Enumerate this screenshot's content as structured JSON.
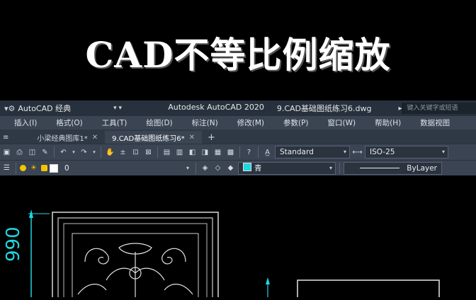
{
  "banner": {
    "title": "CAD不等比例缩放"
  },
  "titlebar": {
    "workspace": "AutoCAD 经典",
    "app_name": "Autodesk AutoCAD 2020",
    "file_name": "9.CAD基础图纸练习6.dwg",
    "search_placeholder": "键入关键字或短语"
  },
  "menu": {
    "items": [
      "插入(I)",
      "格式(O)",
      "工具(T)",
      "绘图(D)",
      "标注(N)",
      "修改(M)",
      "参数(P)",
      "窗口(W)",
      "帮助(H)",
      "数据视图"
    ]
  },
  "tabs": [
    {
      "label": "小梁经典图库1*"
    },
    {
      "label": "9.CAD基础图纸练习6*"
    }
  ],
  "styles": {
    "text_style": "Standard",
    "dim_style": "ISO-25"
  },
  "layer": {
    "name": "0",
    "color_name": "青",
    "linetype": "ByLayer"
  },
  "drawing": {
    "dimension_value": "990"
  },
  "colors": {
    "cyan": "#1fd7e0",
    "panel": "#3b4453",
    "titlebar": "#27313d"
  }
}
